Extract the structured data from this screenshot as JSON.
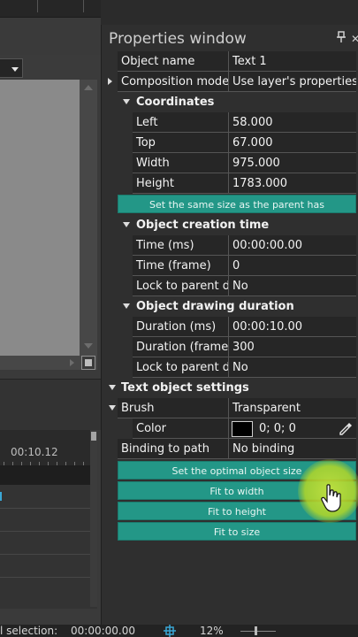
{
  "properties_window": {
    "title": "Properties window",
    "rows": {
      "object_name": {
        "label": "Object name",
        "value": "Text 1"
      },
      "composition_mode": {
        "label": "Composition mode",
        "value": "Use layer's properties"
      },
      "coordinates": {
        "label": "Coordinates"
      },
      "left": {
        "label": "Left",
        "value": "58.000"
      },
      "top": {
        "label": "Top",
        "value": "67.000"
      },
      "width": {
        "label": "Width",
        "value": "975.000"
      },
      "height": {
        "label": "Height",
        "value": "1783.000"
      },
      "same_size_button": "Set the same size as the parent has",
      "creation_time": {
        "label": "Object creation time"
      },
      "time_ms": {
        "label": "Time (ms)",
        "value": "00:00:00.00"
      },
      "time_frame": {
        "label": "Time (frame)",
        "value": "0"
      },
      "lock_parent_1": {
        "label": "Lock to parent duration",
        "value": "No"
      },
      "drawing_duration": {
        "label": "Object drawing duration"
      },
      "duration_ms": {
        "label": "Duration (ms)",
        "value": "00:00:10.00"
      },
      "duration_frame": {
        "label": "Duration (frame)",
        "value": "300"
      },
      "lock_parent_2": {
        "label": "Lock to parent duration",
        "value": "No"
      },
      "text_settings": {
        "label": "Text object settings"
      },
      "brush": {
        "label": "Brush",
        "value": "Transparent"
      },
      "color": {
        "label": "Color",
        "value": "0; 0; 0"
      },
      "binding": {
        "label": "Binding to path",
        "value": "No binding"
      }
    },
    "buttons": {
      "optimal_size": "Set the optimal object size",
      "fit_width": "Fit to width",
      "fit_height": "Fit to height",
      "fit_size": "Fit to size"
    }
  },
  "timeline": {
    "ruler_label": "00:10.12"
  },
  "status_bar": {
    "selection_label": "l selection:",
    "selection_time": "00:00:00.00",
    "zoom": "12%"
  },
  "colors": {
    "accent_button": "#239787",
    "color_swatch": "#000000",
    "highlight": "#c4e23c"
  },
  "icons": [
    "pin-icon",
    "close-icon",
    "eyedropper-icon",
    "hand-cursor-icon",
    "move-icon",
    "fit-to-window-icon"
  ]
}
